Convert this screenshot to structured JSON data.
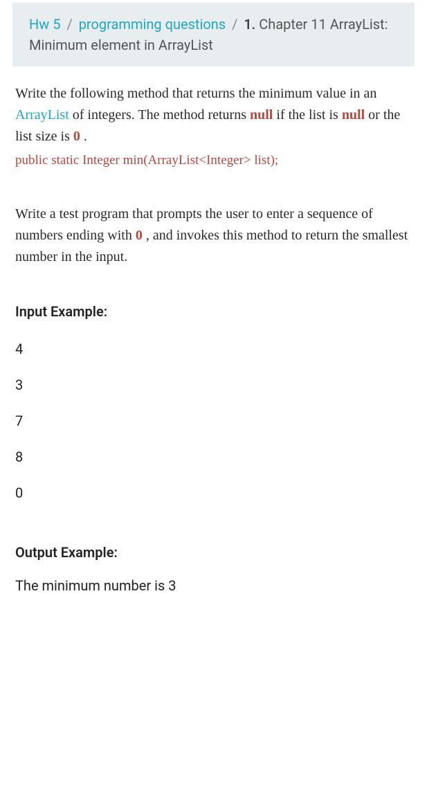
{
  "breadcrumb": {
    "hw": "Hw 5",
    "sep1": "/",
    "pq": "programming questions",
    "sep2": "/",
    "num": "1.",
    "title": "Chapter 11 ArrayList: Minimum element in ArrayList"
  },
  "paragraph1": {
    "pre": "Write the following method that returns the minimum value in an ",
    "arraylist": "ArrayList",
    "mid1": " of integers. The method returns ",
    "null1": "null",
    "mid2": " if the list is ",
    "null2": "null",
    "mid3": " or the list size is ",
    "zero": "0",
    "post": " ."
  },
  "signature": "public static Integer min(ArrayList<Integer> list);",
  "paragraph2": {
    "pre": "Write a test program that prompts the user to enter a sequence of numbers ending with ",
    "zero": "0",
    "post": " , and invokes this method to return the smallest number in the input."
  },
  "input": {
    "header": "Input Example:",
    "lines": [
      "4",
      "3",
      "7",
      "8",
      "0"
    ]
  },
  "output": {
    "header": "Output Example:",
    "line": "The minimum number is 3"
  }
}
